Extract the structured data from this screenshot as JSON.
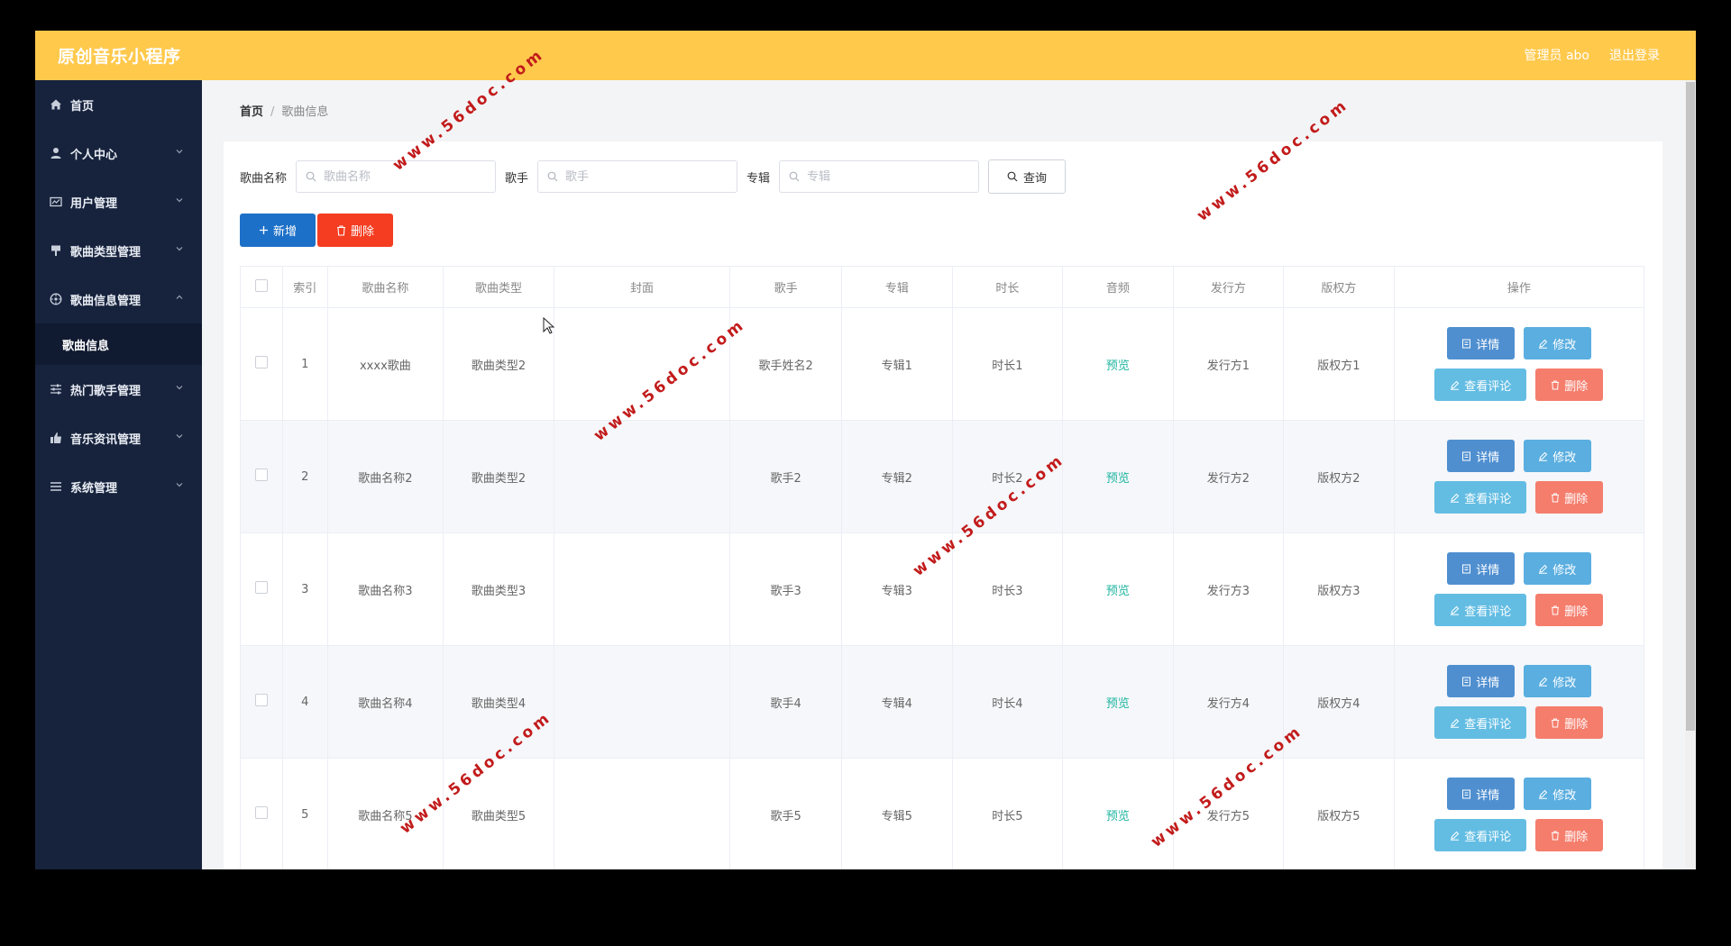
{
  "app": {
    "title": "原创音乐小程序"
  },
  "header": {
    "admin": "管理员 abo",
    "logout": "退出登录"
  },
  "sidebar": {
    "items": [
      {
        "label": "首页",
        "icon": "home-icon"
      },
      {
        "label": "个人中心",
        "icon": "user-icon"
      },
      {
        "label": "用户管理",
        "icon": "id-card-icon"
      },
      {
        "label": "歌曲类型管理",
        "icon": "flag-icon"
      },
      {
        "label": "歌曲信息管理",
        "icon": "disc-icon"
      },
      {
        "label": "热门歌手管理",
        "icon": "sliders-icon"
      },
      {
        "label": "音乐资讯管理",
        "icon": "thumb-icon"
      },
      {
        "label": "系统管理",
        "icon": "menu-icon"
      }
    ],
    "sub_item": "歌曲信息"
  },
  "breadcrumb": {
    "home": "首页",
    "sep": "/",
    "current": "歌曲信息"
  },
  "search": {
    "song_label": "歌曲名称",
    "song_placeholder": "歌曲名称",
    "singer_label": "歌手",
    "singer_placeholder": "歌手",
    "album_label": "专辑",
    "album_placeholder": "专辑",
    "query_label": "查询"
  },
  "actions": {
    "add": "新增",
    "delete": "删除"
  },
  "table": {
    "headers": [
      "索引",
      "歌曲名称",
      "歌曲类型",
      "封面",
      "歌手",
      "专辑",
      "时长",
      "音频",
      "发行方",
      "版权方",
      "操作"
    ],
    "rows": [
      [
        "1",
        "xxxx歌曲",
        "歌曲类型2",
        "",
        "歌手姓名2",
        "专辑1",
        "时长1",
        "预览",
        "发行方1",
        "版权方1"
      ],
      [
        "2",
        "歌曲名称2",
        "歌曲类型2",
        "",
        "歌手2",
        "专辑2",
        "时长2",
        "预览",
        "发行方2",
        "版权方2"
      ],
      [
        "3",
        "歌曲名称3",
        "歌曲类型3",
        "",
        "歌手3",
        "专辑3",
        "时长3",
        "预览",
        "发行方3",
        "版权方3"
      ],
      [
        "4",
        "歌曲名称4",
        "歌曲类型4",
        "",
        "歌手4",
        "专辑4",
        "时长4",
        "预览",
        "发行方4",
        "版权方4"
      ],
      [
        "5",
        "歌曲名称5",
        "歌曲类型5",
        "",
        "歌手5",
        "专辑5",
        "时长5",
        "预览",
        "发行方5",
        "版权方5"
      ]
    ],
    "ops": {
      "detail": "详情",
      "edit": "修改",
      "comment": "查看评论",
      "remove": "删除"
    }
  },
  "watermark": "www.56doc.com"
}
